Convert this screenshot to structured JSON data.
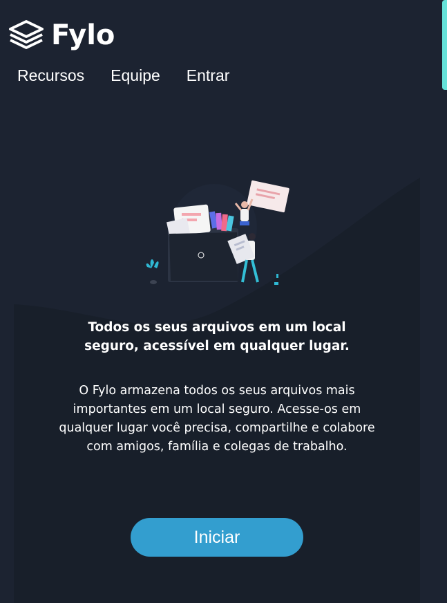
{
  "brand": {
    "name": "Fylo",
    "icon": "stacked-layers-logo-icon"
  },
  "nav": {
    "items": [
      {
        "label": "Recursos"
      },
      {
        "label": "Equipe"
      },
      {
        "label": "Entrar"
      }
    ]
  },
  "hero": {
    "illustration_icon": "file-sharing-illustration",
    "headline": "Todos os seus arquivos em um local seguro, acessível em qualquer lugar.",
    "description": "O Fylo armazena todos os seus arquivos mais importantes em um local seguro. Acesse-os em qualquer lugar você precisa, compartilhe e colabore com amigos, família e colegas de trabalho.",
    "cta_label": "Iniciar"
  },
  "colors": {
    "background": "#1c2331",
    "panel": "#181f2a",
    "accent_button": "#339ecf",
    "scroll_thumb": "#65e2d9"
  }
}
